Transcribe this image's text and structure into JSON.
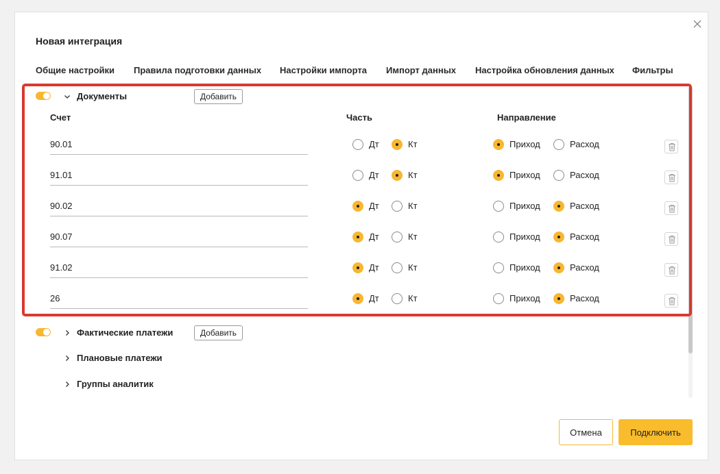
{
  "dialog": {
    "title": "Новая интеграция",
    "close_icon": "close-icon"
  },
  "tabs": [
    {
      "label": "Общие настройки"
    },
    {
      "label": "Правила подготовки данных"
    },
    {
      "label": "Настройки импорта"
    },
    {
      "label": "Импорт данных"
    },
    {
      "label": "Настройка обновления данных"
    },
    {
      "label": "Фильтры"
    }
  ],
  "documents": {
    "label": "Документы",
    "enabled": true,
    "expanded": true,
    "add_label": "Добавить",
    "columns": {
      "account": "Счет",
      "part": "Часть",
      "direction": "Направление"
    },
    "part_options": {
      "debit": "Дт",
      "credit": "Кт"
    },
    "direction_options": {
      "income": "Приход",
      "expense": "Расход"
    },
    "rows": [
      {
        "account": "90.01",
        "part": "Кт",
        "direction": "Приход"
      },
      {
        "account": "91.01",
        "part": "Кт",
        "direction": "Приход"
      },
      {
        "account": "90.02",
        "part": "Дт",
        "direction": "Расход"
      },
      {
        "account": "90.07",
        "part": "Дт",
        "direction": "Расход"
      },
      {
        "account": "91.02",
        "part": "Дт",
        "direction": "Расход"
      },
      {
        "account": "26",
        "part": "Дт",
        "direction": "Расход"
      }
    ]
  },
  "sections": {
    "actual_payments": {
      "label": "Фактические платежи",
      "enabled": true,
      "add_label": "Добавить"
    },
    "planned_payments": {
      "label": "Плановые платежи"
    },
    "analytics_groups": {
      "label": "Группы аналитик"
    }
  },
  "footer": {
    "cancel_label": "Отмена",
    "connect_label": "Подключить"
  },
  "colors": {
    "accent": "#f7b731",
    "highlight": "#d93a2f"
  }
}
